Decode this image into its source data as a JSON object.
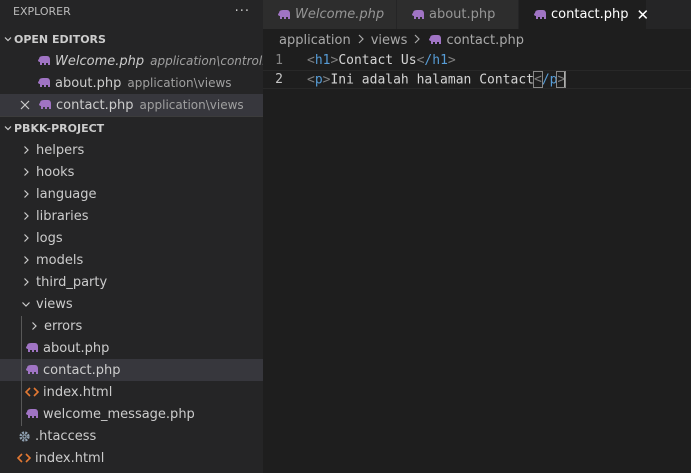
{
  "explorer": {
    "title": "EXPLORER",
    "more": "···",
    "open_editors": {
      "label": "OPEN EDITORS",
      "items": [
        {
          "name": "Welcome.php",
          "desc": "application\\controllers"
        },
        {
          "name": "about.php",
          "desc": "application\\views"
        },
        {
          "name": "contact.php",
          "desc": "application\\views"
        }
      ]
    },
    "project": {
      "label": "PBKK-PROJECT",
      "folders": [
        "helpers",
        "hooks",
        "language",
        "libraries",
        "logs",
        "models",
        "third_party",
        "views"
      ],
      "views_children": {
        "folder": "errors",
        "files": [
          "about.php",
          "contact.php",
          "index.html",
          "welcome_message.php"
        ]
      },
      "root_files": [
        ".htaccess",
        "index.html"
      ]
    }
  },
  "tabs": [
    {
      "label": "Welcome.php"
    },
    {
      "label": "about.php"
    },
    {
      "label": "contact.php",
      "close": "✕"
    }
  ],
  "breadcrumb": {
    "parts": [
      "application",
      "views",
      "contact.php"
    ]
  },
  "editor": {
    "lines": [
      {
        "num": "1",
        "open_tag": "h1",
        "text": "Contact Us",
        "close_tag": "/h1"
      },
      {
        "num": "2",
        "open_tag": "p",
        "text": "Ini adalah halaman Contact",
        "close_tag": "/p"
      }
    ]
  },
  "colors": {
    "php_icon": "#a074c4",
    "html_icon": "#e37933",
    "tag": "#569cd6",
    "bracket": "#808080"
  }
}
